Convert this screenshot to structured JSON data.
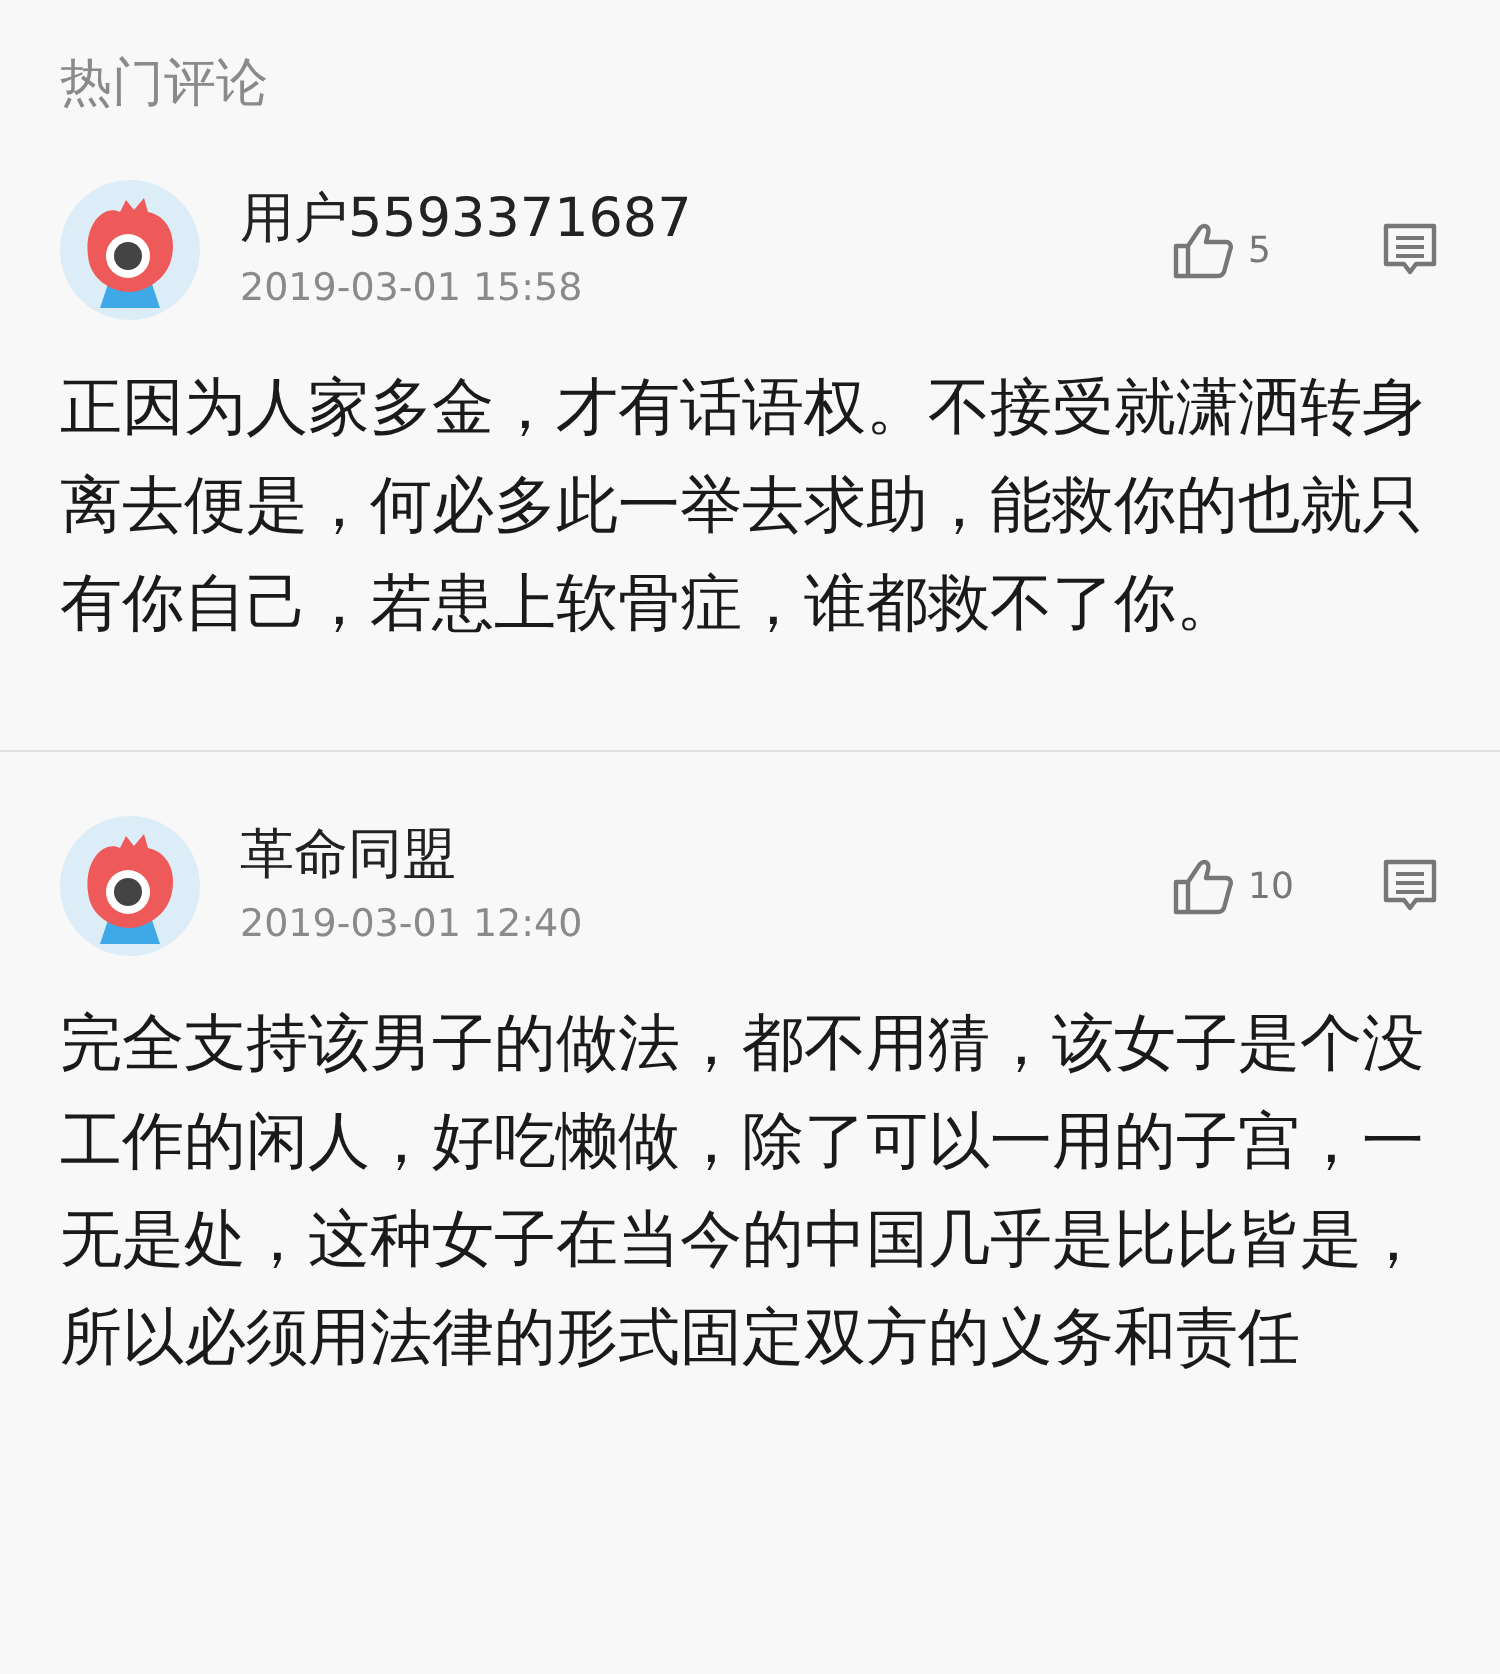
{
  "section_title": "热门评论",
  "comments": [
    {
      "user": "用户5593371687",
      "time": "2019-03-01 15:58",
      "likes": "5",
      "text": "正因为人家多金，才有话语权。不接受就潇洒转身离去便是，何必多此一举去求助，能救你的也就只有你自己，若患上软骨症，谁都救不了你。"
    },
    {
      "user": "革命同盟",
      "time": "2019-03-01 12:40",
      "likes": "10",
      "text": "完全支持该男子的做法，都不用猜，该女子是个没工作的闲人，好吃懒做，除了可以一用的子宫，一无是处，这种女子在当今的中国几乎是比比皆是，所以必须用法律的形式固定双方的义务和责任"
    }
  ]
}
